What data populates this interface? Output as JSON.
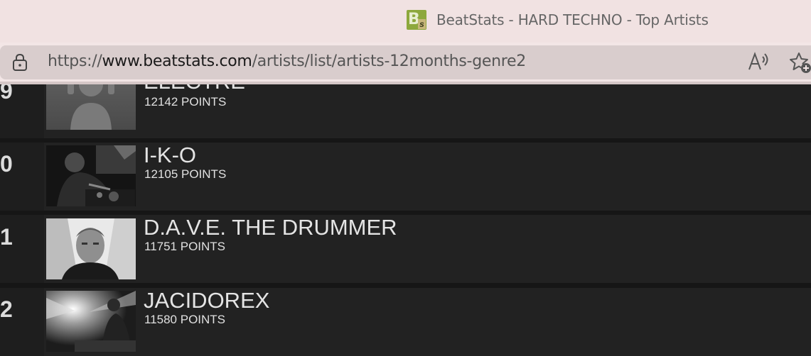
{
  "browser": {
    "tab": {
      "title": "BeatStats - HARD TECHNO - Top Artists",
      "favicon_letter": "B",
      "favicon_sub": "s"
    },
    "address": {
      "prefix": "https://",
      "host": "www.beatstats.com",
      "path": "/artists/list/artists-12months-genre2"
    },
    "icons": [
      "lock-icon",
      "read-aloud-icon",
      "add-favorite-icon"
    ]
  },
  "artists": [
    {
      "rank": "9",
      "name": "ELECTRE",
      "points": "12142 POINTS",
      "photo": "placeholder-avatar"
    },
    {
      "rank": "0",
      "name": "I-K-O",
      "points": "12105 POINTS",
      "photo": "dj-at-decks"
    },
    {
      "rank": "1",
      "name": "D.A.V.E. THE DRUMMER",
      "points": "11751 POINTS",
      "photo": "portrait"
    },
    {
      "rank": "2",
      "name": "JACIDOREX",
      "points": "11580 POINTS",
      "photo": "stage-lights"
    }
  ],
  "colors": {
    "row_bg": "#222222",
    "page_bg": "#161616",
    "text": "#e4e4e4",
    "chrome_bg": "#f1e2e2"
  }
}
